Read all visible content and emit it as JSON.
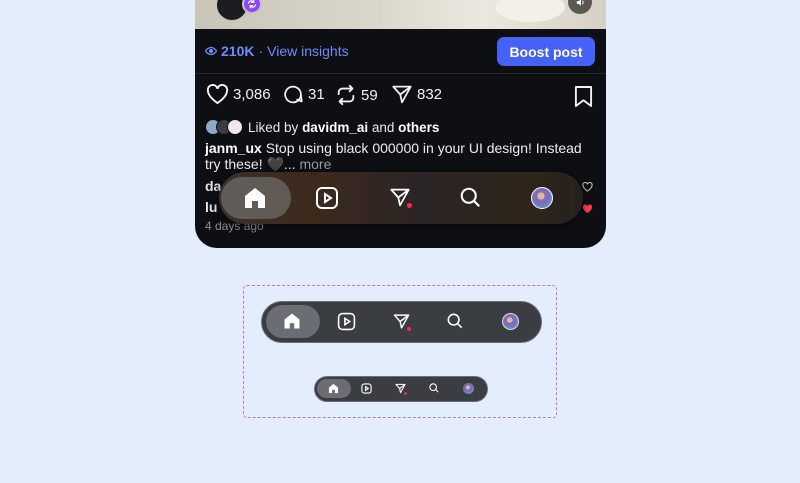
{
  "post": {
    "views": "210K",
    "insights_label": "View insights",
    "boost_label": "Boost post",
    "likes": "3,086",
    "comments": "31",
    "reposts": "59",
    "shares": "832",
    "liked_by_prefix": "Liked by",
    "liked_by_user": "davidm_ai",
    "liked_by_and": "and",
    "liked_by_others": "others",
    "caption_user": "janm_ux",
    "caption_text": "Stop using black 000000 in your UI design! Instead try these! 🖤...",
    "caption_more": "more",
    "comment1_user": "da",
    "comment2_user": "lu",
    "timestamp": "4 days ago"
  },
  "nav_bar": {
    "items": [
      "home-icon",
      "reels-icon",
      "send-icon",
      "search-icon",
      "profile-avatar"
    ],
    "active": "home-icon",
    "send_has_notification": true
  },
  "colors": {
    "background": "#e4edfb",
    "phone_bg": "#0d0f13",
    "accent_blue": "#4661f5",
    "link_blue": "#6f8cff",
    "notification_red": "#ff2b4a",
    "frame_dashed": "#b27bd1"
  }
}
